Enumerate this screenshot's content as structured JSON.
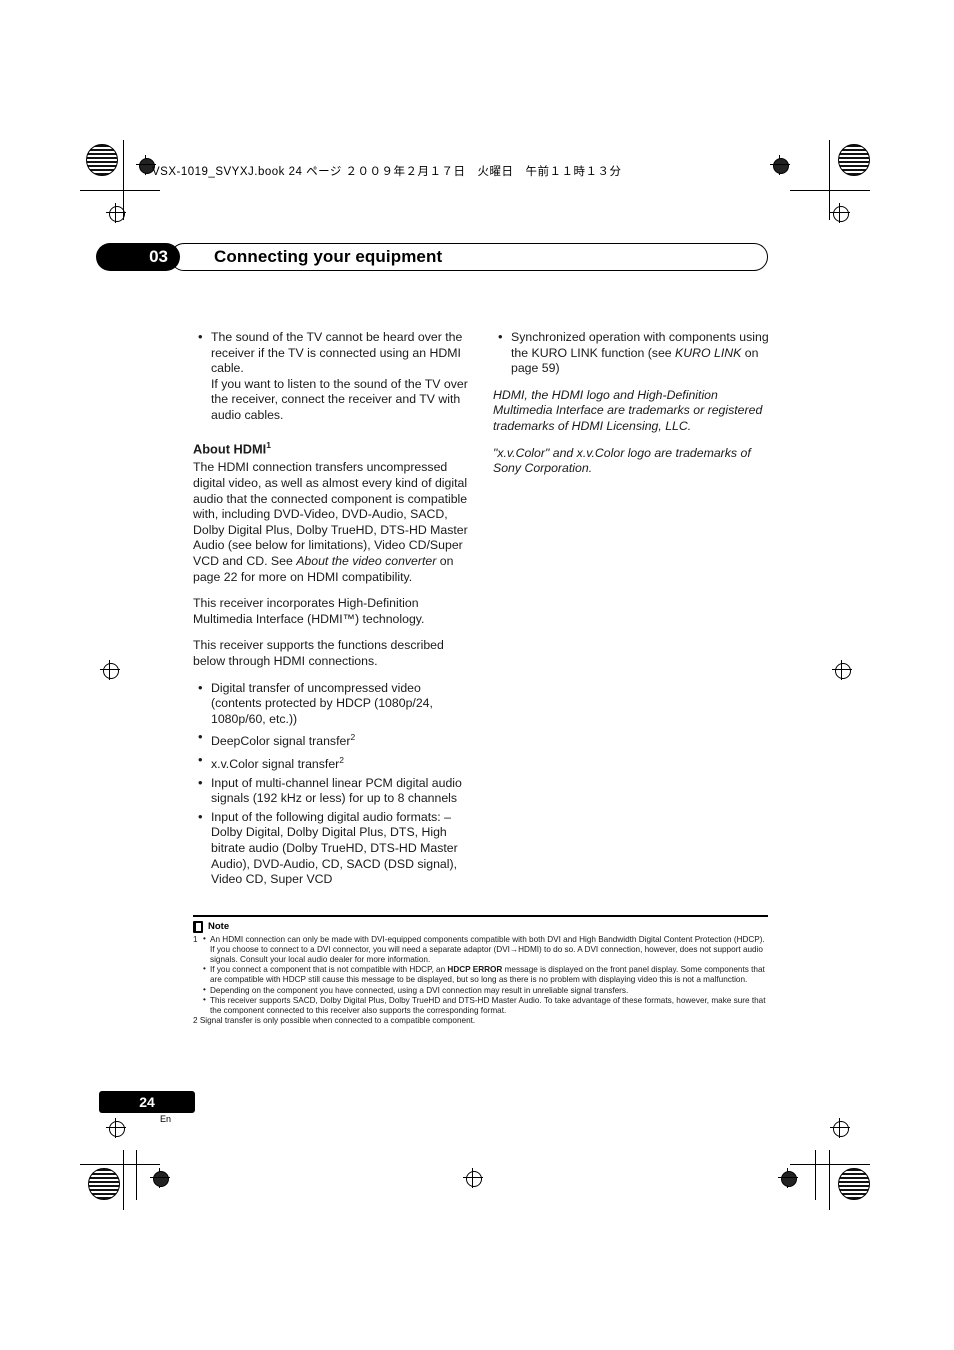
{
  "header": {
    "filename_line": "VSX-1019_SVYXJ.book   24 ページ   ２００９年２月１７日　火曜日　午前１１時１３分"
  },
  "chapter": {
    "number": "03",
    "title": "Connecting your equipment"
  },
  "left_column": {
    "bullets_top": [
      "The sound of the TV cannot be heard over the receiver if the TV is connected using an HDMI cable.",
      "If you want to listen to the sound of the TV over the receiver, connect the receiver and TV with audio cables."
    ],
    "heading": "About HDMI",
    "heading_sup": "1",
    "para1_a": "The HDMI connection transfers uncompressed digital video, as well as almost every kind of digital audio that the connected component is compatible with, including DVD-Video, DVD-Audio, SACD, Dolby Digital Plus, Dolby TrueHD, DTS-HD Master Audio (see below for limitations), Video CD/Super VCD and CD. See ",
    "para1_italic": "About the video converter",
    "para1_b": " on page 22 for more on HDMI compatibility.",
    "para2": "This receiver incorporates High-Definition Multimedia Interface (HDMI™) technology.",
    "para3": "This receiver supports the functions described below through HDMI connections.",
    "feature_bullets": [
      "Digital transfer of uncompressed video (contents protected by HDCP (1080p/24, 1080p/60, etc.))",
      "DeepColor signal transfer",
      "x.v.Color signal transfer",
      "Input of multi-channel linear PCM digital audio signals (192 kHz or less) for up to 8 channels",
      "Input of the following digital audio formats: – Dolby Digital, Dolby Digital Plus, DTS, High bitrate audio (Dolby TrueHD, DTS-HD Master Audio), DVD-Audio, CD, SACD (DSD signal), Video CD, Super VCD"
    ],
    "sup_deepcolor": "2",
    "sup_xvcolor": "2"
  },
  "right_column": {
    "bullet_a": "Synchronized operation with components using the KURO LINK function (see ",
    "bullet_a_italic": "KURO LINK",
    "bullet_a_end": " on page 59)",
    "trademark1": "HDMI, the HDMI logo and High-Definition Multimedia Interface are trademarks or registered trademarks of HDMI Licensing, LLC.",
    "trademark2": "\"x.v.Color\" and x.v.Color logo are trademarks of Sony Corporation."
  },
  "note": {
    "title": "Note",
    "items": [
      {
        "marker": "1",
        "text": "An HDMI connection can only be made with DVI-equipped components compatible with both DVI and High Bandwidth Digital Content Protection (HDCP). If you choose to connect to a DVI connector, you will need a separate adaptor (DVI→HDMI) to do so. A DVI connection, however, does not support audio signals. Consult your local audio dealer for more information."
      },
      {
        "marker": "",
        "text_a": "If you connect a component that is not compatible with HDCP, an ",
        "bold": "HDCP ERROR",
        "text_b": " message is displayed on the front panel display. Some components that are compatible with HDCP still cause this message to be displayed, but so long as there is no problem with displaying video this is not a malfunction."
      },
      {
        "marker": "",
        "text": "Depending on the component you have connected, using a DVI connection may result in unreliable signal transfers."
      },
      {
        "marker": "",
        "text": "This receiver supports SACD, Dolby Digital Plus, Dolby TrueHD and DTS-HD Master Audio. To take advantage of these formats, however, make sure that the component connected to this receiver also supports the corresponding format."
      }
    ],
    "footnote2": "2 Signal transfer is only possible when connected to a compatible component."
  },
  "footer": {
    "page_number": "24",
    "language": "En"
  }
}
